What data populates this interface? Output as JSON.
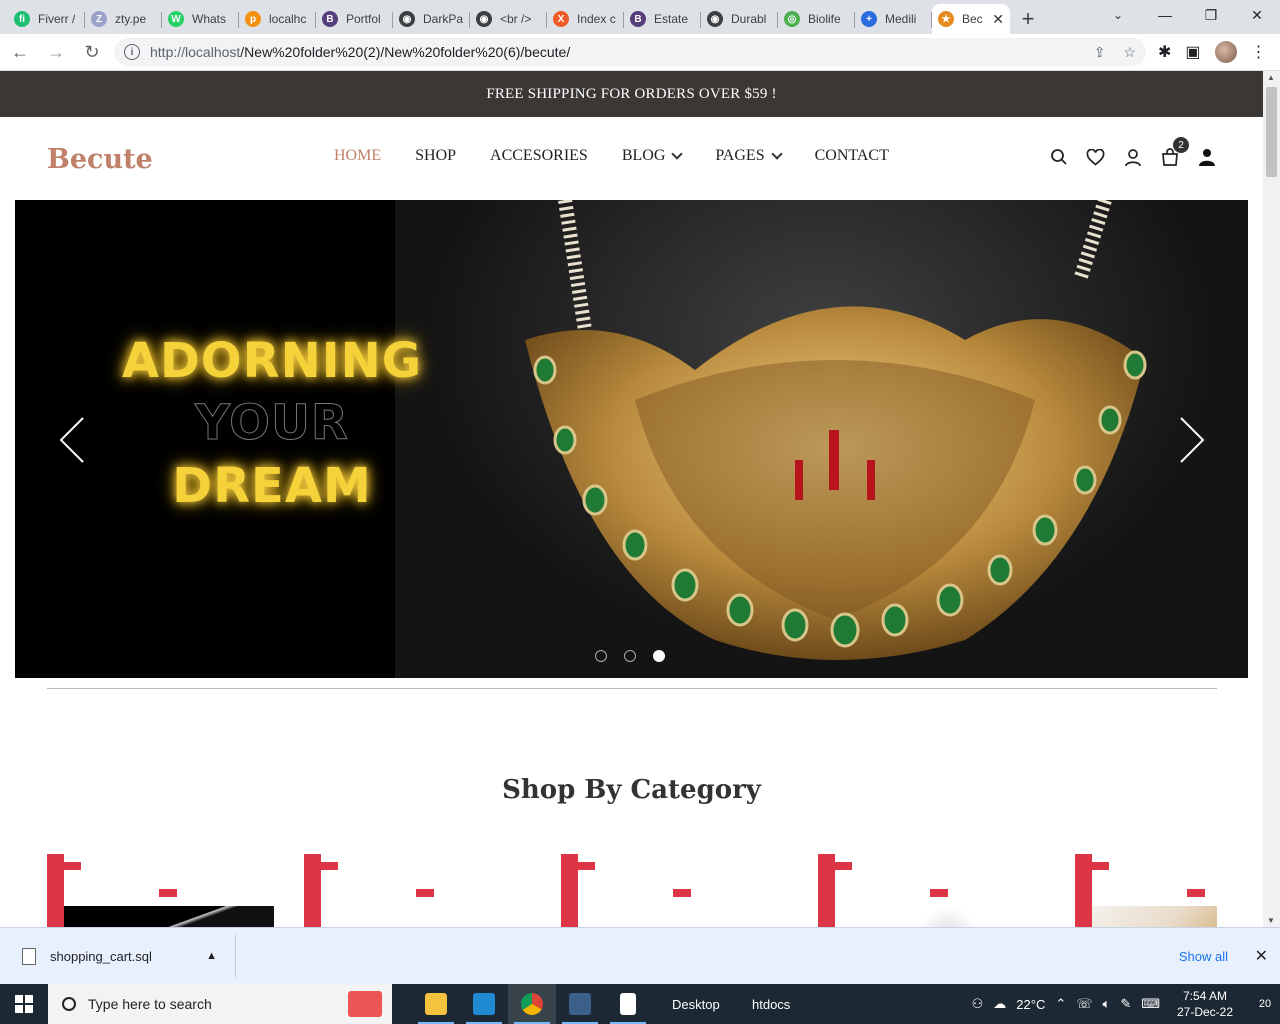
{
  "browser": {
    "tabs": [
      {
        "label": "Fiverr /",
        "color": "#1dbf73",
        "glyph": "fi"
      },
      {
        "label": "zty.pe",
        "color": "#9aa0c8",
        "glyph": "Z"
      },
      {
        "label": "Whats",
        "color": "#25d366",
        "glyph": "W"
      },
      {
        "label": "localhc",
        "color": "#f29111",
        "glyph": "p"
      },
      {
        "label": "Portfol",
        "color": "#563d7c",
        "glyph": "B"
      },
      {
        "label": "DarkPa",
        "color": "#3c4043",
        "glyph": "◉"
      },
      {
        "label": "<br />",
        "color": "#3c4043",
        "glyph": "◉"
      },
      {
        "label": "Index c",
        "color": "#f05a28",
        "glyph": "X"
      },
      {
        "label": "Estate",
        "color": "#563d7c",
        "glyph": "B"
      },
      {
        "label": "Durabl",
        "color": "#3c4043",
        "glyph": "◉"
      },
      {
        "label": "Biolife",
        "color": "#4caf50",
        "glyph": "◎"
      },
      {
        "label": "Medili",
        "color": "#2d6cdf",
        "glyph": "+"
      }
    ],
    "active_tab": {
      "label": "Bec",
      "color": "#e58a1f",
      "glyph": "★"
    },
    "new_tab_label": "+",
    "url": "http://localhost/New%20folder%20(2)/New%20folder%20(6)/becute/",
    "url_host": "http://localhost",
    "url_path": "/New%20folder%20(2)/New%20folder%20(6)/becute/"
  },
  "site": {
    "promo": "FREE SHIPPING FOR ORDERS OVER $59 !",
    "logo": "Becute",
    "nav": {
      "home": "HOME",
      "shop": "SHOP",
      "accessories": "ACCESORIES",
      "blog": "BLOG",
      "pages": "PAGES",
      "contact": "CONTACT"
    },
    "cart_count": "2",
    "accent": "#c0806a",
    "hero": {
      "line1": "ADORNING",
      "line2": "YOUR",
      "line3": "DREAM",
      "active_slide": 3,
      "slide_count": 3
    },
    "section_title": "Shop By Category",
    "category_accent": "#dc3545"
  },
  "downloads": {
    "file": "shopping_cart.sql",
    "show_all": "Show all"
  },
  "taskbar": {
    "search_placeholder": "Type here to search",
    "folder1": "Desktop",
    "folder2": "htdocs",
    "temperature": "22°C",
    "time": "7:54 AM",
    "date": "27-Dec-22",
    "notifications": "20"
  }
}
